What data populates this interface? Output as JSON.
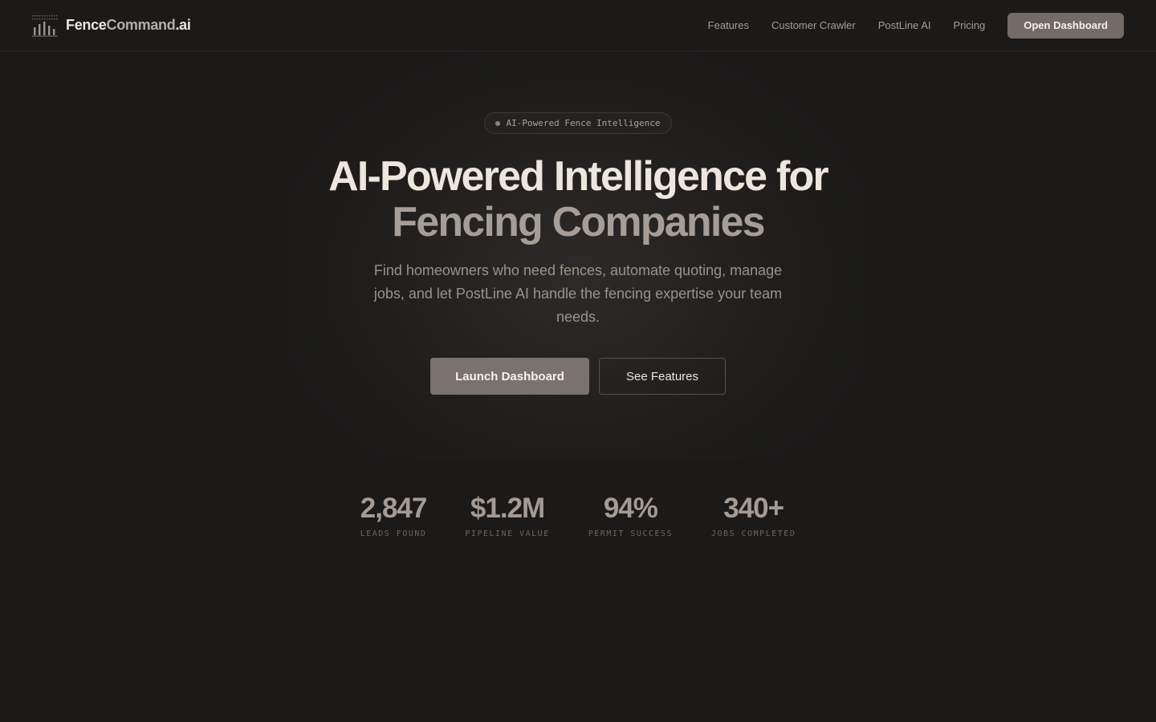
{
  "nav": {
    "brand": {
      "part1": "Fence",
      "part2": "Command",
      "part3": ".ai"
    },
    "links": [
      "Features",
      "Customer Crawler",
      "PostLine AI",
      "Pricing"
    ],
    "cta_label": "Open Dashboard",
    "logo_icon": "bar-chart-icon"
  },
  "hero": {
    "badge": "AI-Powered Fence Intelligence",
    "title_line1": "AI-Powered Intelligence for",
    "title_line2": "Fencing Companies",
    "subtitle": "Find homeowners who need fences, automate quoting, manage jobs, and let PostLine AI handle the fencing expertise your team needs.",
    "primary_cta": "Launch Dashboard",
    "secondary_cta": "See Features"
  },
  "stats": [
    {
      "value": "2,847",
      "label": "LEADS FOUND"
    },
    {
      "value": "$1.2M",
      "label": "PIPELINE VALUE"
    },
    {
      "value": "94%",
      "label": "PERMIT SUCCESS"
    },
    {
      "value": "340+",
      "label": "JOBS COMPLETED"
    }
  ],
  "colors": {
    "background": "#1b1a19",
    "accent_button": "#726b66",
    "heading": "#ede6de",
    "muted_heading": "#a59d96"
  }
}
